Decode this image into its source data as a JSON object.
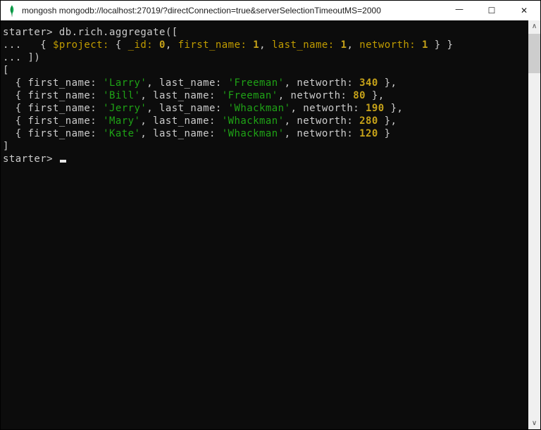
{
  "window": {
    "title": "mongosh mongodb://localhost:27019/?directConnection=true&serverSelectionTimeoutMS=2000",
    "app_icon": "mongodb-leaf-icon",
    "controls": {
      "minimize": "—",
      "maximize": "☐",
      "close": "✕"
    }
  },
  "colors": {
    "background": "#0c0c0c",
    "foreground": "#cccccc",
    "string_green": "#1fa316",
    "number_yellow": "#c6a219",
    "key_yellow": "#c19c00",
    "titlebar_bg": "#ffffff",
    "mongodb_green": "#10aa50",
    "scrollbar_track": "#f0f0f0",
    "scrollbar_thumb": "#cdcdcd"
  },
  "scrollbar": {
    "up_glyph": "∧",
    "down_glyph": "∨"
  },
  "terminal": {
    "prompt": "starter>",
    "cursor_line": 10,
    "lines": [
      [
        {
          "t": "starter> db.rich.aggregate([",
          "c": "fg"
        }
      ],
      [
        {
          "t": "...   { ",
          "c": "fg"
        },
        {
          "t": "$project:",
          "c": "key"
        },
        {
          "t": " { ",
          "c": "fg"
        },
        {
          "t": "_id:",
          "c": "key"
        },
        {
          "t": " ",
          "c": "fg"
        },
        {
          "t": "0",
          "c": "num"
        },
        {
          "t": ", ",
          "c": "fg"
        },
        {
          "t": "first_name:",
          "c": "key"
        },
        {
          "t": " ",
          "c": "fg"
        },
        {
          "t": "1",
          "c": "num"
        },
        {
          "t": ", ",
          "c": "fg"
        },
        {
          "t": "last_name:",
          "c": "key"
        },
        {
          "t": " ",
          "c": "fg"
        },
        {
          "t": "1",
          "c": "num"
        },
        {
          "t": ", ",
          "c": "fg"
        },
        {
          "t": "networth:",
          "c": "key"
        },
        {
          "t": " ",
          "c": "fg"
        },
        {
          "t": "1",
          "c": "num"
        },
        {
          "t": " } }",
          "c": "fg"
        }
      ],
      [
        {
          "t": "... ])",
          "c": "fg"
        }
      ],
      [
        {
          "t": "[",
          "c": "fg"
        }
      ],
      [
        {
          "t": "  { first_name: ",
          "c": "fg"
        },
        {
          "t": "'Larry'",
          "c": "str"
        },
        {
          "t": ", last_name: ",
          "c": "fg"
        },
        {
          "t": "'Freeman'",
          "c": "str"
        },
        {
          "t": ", networth: ",
          "c": "fg"
        },
        {
          "t": "340",
          "c": "num"
        },
        {
          "t": " },",
          "c": "fg"
        }
      ],
      [
        {
          "t": "  { first_name: ",
          "c": "fg"
        },
        {
          "t": "'Bill'",
          "c": "str"
        },
        {
          "t": ", last_name: ",
          "c": "fg"
        },
        {
          "t": "'Freeman'",
          "c": "str"
        },
        {
          "t": ", networth: ",
          "c": "fg"
        },
        {
          "t": "80",
          "c": "num"
        },
        {
          "t": " },",
          "c": "fg"
        }
      ],
      [
        {
          "t": "  { first_name: ",
          "c": "fg"
        },
        {
          "t": "'Jerry'",
          "c": "str"
        },
        {
          "t": ", last_name: ",
          "c": "fg"
        },
        {
          "t": "'Whackman'",
          "c": "str"
        },
        {
          "t": ", networth: ",
          "c": "fg"
        },
        {
          "t": "190",
          "c": "num"
        },
        {
          "t": " },",
          "c": "fg"
        }
      ],
      [
        {
          "t": "  { first_name: ",
          "c": "fg"
        },
        {
          "t": "'Mary'",
          "c": "str"
        },
        {
          "t": ", last_name: ",
          "c": "fg"
        },
        {
          "t": "'Whackman'",
          "c": "str"
        },
        {
          "t": ", networth: ",
          "c": "fg"
        },
        {
          "t": "280",
          "c": "num"
        },
        {
          "t": " },",
          "c": "fg"
        }
      ],
      [
        {
          "t": "  { first_name: ",
          "c": "fg"
        },
        {
          "t": "'Kate'",
          "c": "str"
        },
        {
          "t": ", last_name: ",
          "c": "fg"
        },
        {
          "t": "'Whackman'",
          "c": "str"
        },
        {
          "t": ", networth: ",
          "c": "fg"
        },
        {
          "t": "120",
          "c": "num"
        },
        {
          "t": " }",
          "c": "fg"
        }
      ],
      [
        {
          "t": "]",
          "c": "fg"
        }
      ],
      [
        {
          "t": "starter> ",
          "c": "fg"
        }
      ]
    ]
  }
}
